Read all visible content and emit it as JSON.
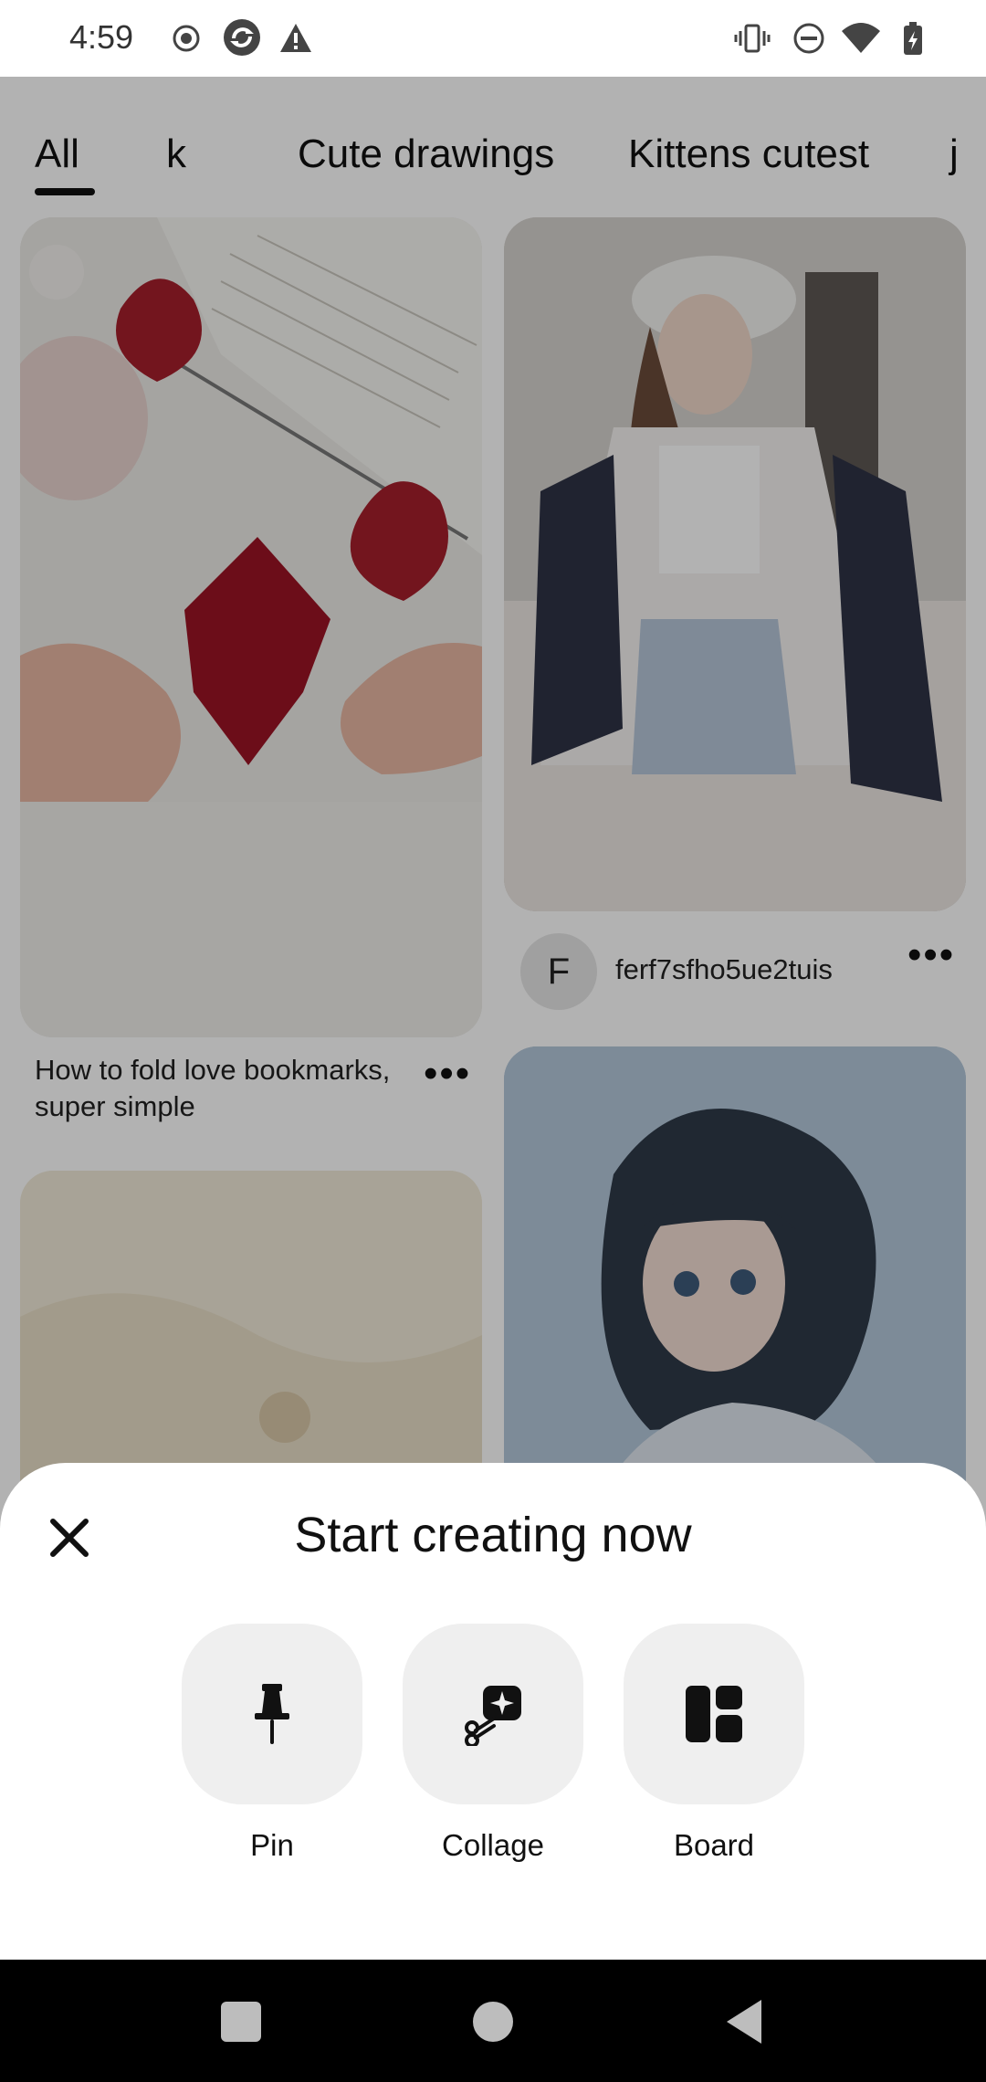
{
  "status_bar": {
    "time": "4:59"
  },
  "tabs": [
    "All",
    "k",
    "Cute drawings",
    "Kittens cutest",
    "j"
  ],
  "feed": {
    "pin1_title": "How to fold love bookmarks, super simple",
    "pin2_author_initial": "F",
    "pin2_author": "ferf7sfho5ue2tuis",
    "more_label": "•••"
  },
  "sheet": {
    "title": "Start creating now",
    "options": [
      {
        "label": "Pin",
        "icon": "pin-icon"
      },
      {
        "label": "Collage",
        "icon": "collage-icon"
      },
      {
        "label": "Board",
        "icon": "board-icon"
      }
    ]
  },
  "colors": {
    "dim": "rgba(0,0,0,0.30)",
    "tile": "#efefef",
    "text": "#111111"
  }
}
